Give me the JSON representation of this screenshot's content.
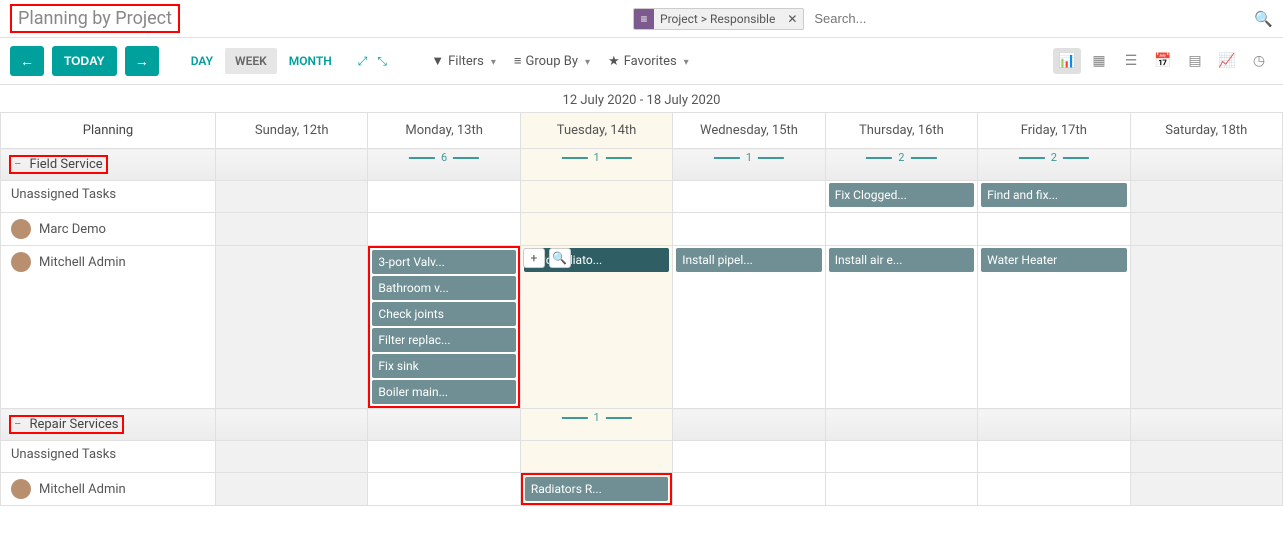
{
  "header": {
    "title": "Planning by Project",
    "facet_label": "Project > Responsible",
    "search_placeholder": "Search..."
  },
  "toolbar": {
    "today": "TODAY",
    "scales": {
      "day": "DAY",
      "week": "WEEK",
      "month": "MONTH"
    },
    "filters": "Filters",
    "groupby": "Group By",
    "favorites": "Favorites"
  },
  "grid": {
    "range": "12 July 2020 - 18 July 2020",
    "side_header": "Planning",
    "days": [
      "Sunday, 12th",
      "Monday, 13th",
      "Tuesday, 14th",
      "Wednesday, 15th",
      "Thursday, 16th",
      "Friday, 17th",
      "Saturday, 18th"
    ],
    "today_index": 2,
    "groups": [
      {
        "name": "Field Service",
        "counts": {
          "1": 6,
          "2": 1,
          "3": 1,
          "4": 2,
          "5": 2
        },
        "rows": [
          {
            "label": "Unassigned Tasks",
            "avatar": false,
            "cells": {
              "4": [
                {
                  "t": "Fix Clogged..."
                }
              ],
              "5": [
                {
                  "t": "Find and fix..."
                }
              ]
            }
          },
          {
            "label": "Marc Demo",
            "avatar": true,
            "cells": {}
          },
          {
            "label": "Mitchell Admin",
            "avatar": true,
            "cells": {
              "1": [
                {
                  "t": "3-port Valv..."
                },
                {
                  "t": "Bathroom v..."
                },
                {
                  "t": "Check joints"
                },
                {
                  "t": "Filter replac..."
                },
                {
                  "t": "Fix sink"
                },
                {
                  "t": "Boiler main..."
                }
              ],
              "2": [
                {
                  "t": "Two radiato...",
                  "dark": true
                }
              ],
              "3": [
                {
                  "t": "Install pipel..."
                }
              ],
              "4": [
                {
                  "t": "Install air e..."
                }
              ],
              "5": [
                {
                  "t": "Water Heater"
                }
              ]
            },
            "stack_redbox_day": 1,
            "hover_day": 2
          }
        ]
      },
      {
        "name": "Repair Services",
        "counts": {
          "2": 1
        },
        "rows": [
          {
            "label": "Unassigned Tasks",
            "avatar": false,
            "cells": {}
          },
          {
            "label": "Mitchell Admin",
            "avatar": true,
            "cells": {
              "2": [
                {
                  "t": "Radiators R..."
                }
              ]
            },
            "single_redbox_day": 2
          }
        ]
      }
    ]
  }
}
